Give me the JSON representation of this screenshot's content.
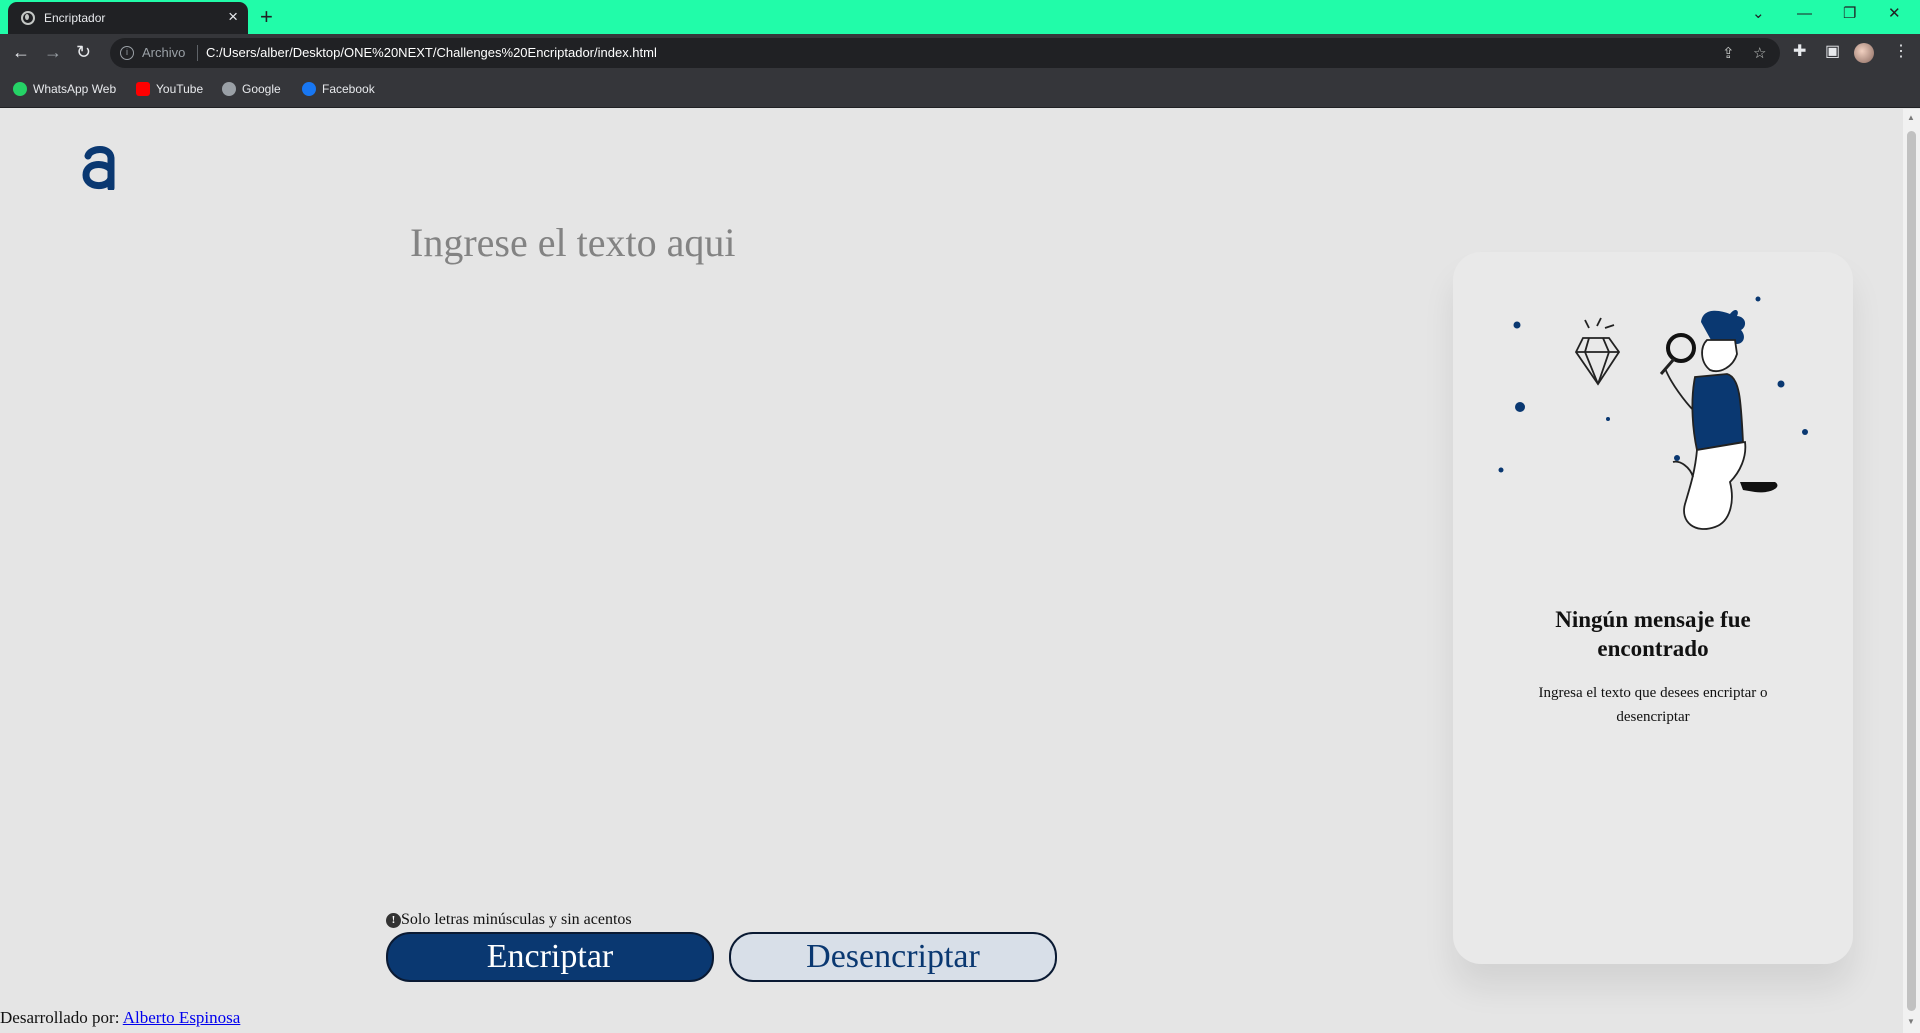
{
  "browser": {
    "tab_title": "Encriptador",
    "omnibox_label": "Archivo",
    "url": "C:/Users/alber/Desktop/ONE%20NEXT/Challenges%20Encriptador/index.html",
    "bookmarks": [
      {
        "label": "WhatsApp Web",
        "icon": "whatsapp-icon",
        "color": "#25d366"
      },
      {
        "label": "YouTube",
        "icon": "youtube-icon",
        "color": "#ff0000"
      },
      {
        "label": "Google",
        "icon": "google-icon",
        "color": "#9aa0a6"
      },
      {
        "label": "Facebook",
        "icon": "facebook-icon",
        "color": "#1877f2"
      }
    ],
    "tab_accent": "#21fca9"
  },
  "page": {
    "logo": "a",
    "textarea_placeholder": "Ingrese el texto aqui",
    "hint": "Solo letras minúsculas y sin acentos",
    "hint_icon": "!",
    "encrypt_label": "Encriptar",
    "decrypt_label": "Desencriptar",
    "footer_prefix": "Desarrollado por: ",
    "footer_link": "Alberto Espinosa",
    "card": {
      "title": "Ningún mensaje fue encontrado",
      "text": "Ingresa el texto que desees encriptar o desencriptar"
    },
    "colors": {
      "primary": "#0a3871",
      "background": "#e5e5e5"
    }
  }
}
